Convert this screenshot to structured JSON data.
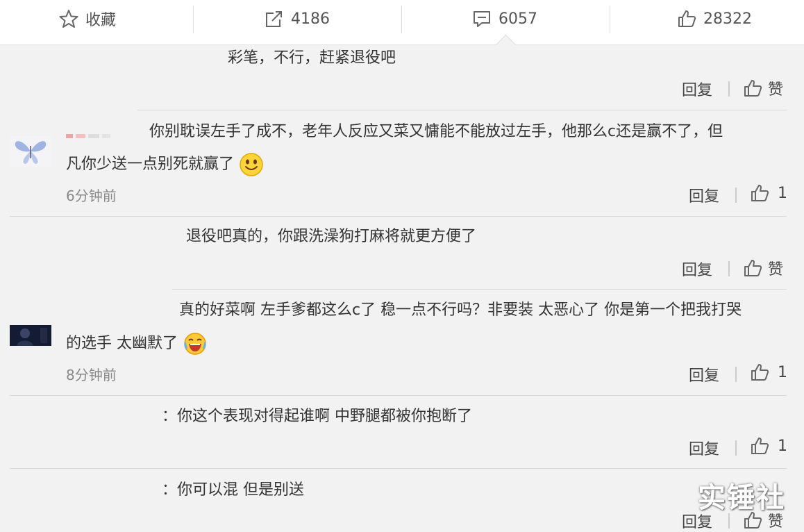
{
  "topbar": {
    "favorite_label": "收藏",
    "repost_count": "4186",
    "comment_count": "6057",
    "like_count": "28322"
  },
  "actions": {
    "reply_label": "回复",
    "like_label": "赞"
  },
  "comments": [
    {
      "text": "彩笔，不行，赶紧退役吧"
    },
    {
      "text_line1": "你别耽误左手了成不，老年人反应又菜又慵能不能放过左手，他那么c还是赢不了，但",
      "text_line2": "凡你少送一点别死就赢了",
      "time": "6分钟前",
      "likes": "1"
    },
    {
      "text": "退役吧真的，你跟洗澡狗打麻将就更方便了"
    },
    {
      "text_line1": "真的好菜啊 左手爹都这么c了 稳一点不行吗？非要装 太恶心了 你是第一个把我打哭",
      "text_line2": "的选手 太幽默了",
      "time": "8分钟前",
      "likes": "1"
    },
    {
      "prefix": "：",
      "text": "你这个表现对得起谁啊 中野腿都被你抱断了",
      "likes": "1"
    },
    {
      "prefix": "：",
      "text": "你可以混 但是别送"
    }
  ],
  "watermark": "实锤社",
  "icons": {
    "favorite": "star-icon",
    "repost": "share-icon",
    "comment": "comment-icon",
    "like": "thumbs-up-icon",
    "smile": "smile-emoji",
    "crying": "crying-laughing-emoji"
  }
}
